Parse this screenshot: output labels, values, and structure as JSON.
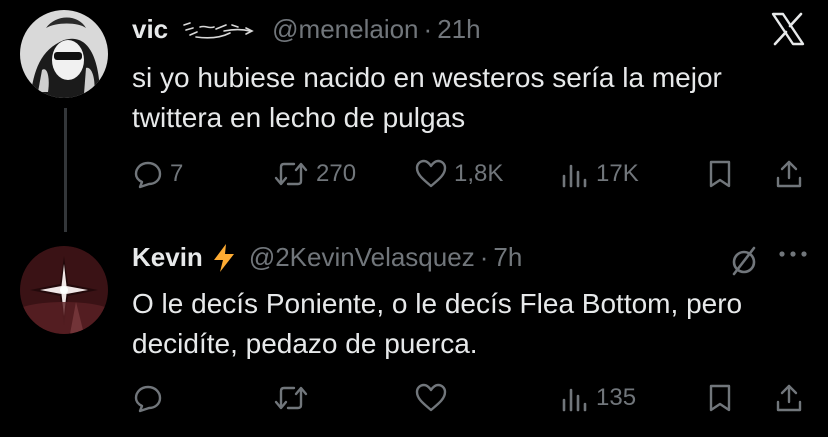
{
  "tweets": [
    {
      "display_name": "vic",
      "handle": "@menelaion",
      "time": "21h",
      "text": "si yo hubiese nacido en westeros sería la mejor twittera en lecho de pulgas",
      "replies": "7",
      "retweets": "270",
      "likes": "1,8K",
      "views": "17K",
      "corner_icon": "x-logo-icon"
    },
    {
      "display_name": "Kevin",
      "name_emoji": "lightning-bolt-icon",
      "handle": "@2KevinVelasquez",
      "time": "7h",
      "text": "O le decís Poniente, o le decís Flea Bottom, pero decidíte, pedazo de puerca.",
      "replies": "",
      "retweets": "",
      "likes": "",
      "views": "135",
      "corner_icons": [
        "mute-icon",
        "more-icon"
      ]
    }
  ],
  "colors": {
    "background": "#000000",
    "text": "#e7e9ea",
    "muted": "#71767b",
    "thread_line": "#333639",
    "bolt": "#ffac33"
  }
}
